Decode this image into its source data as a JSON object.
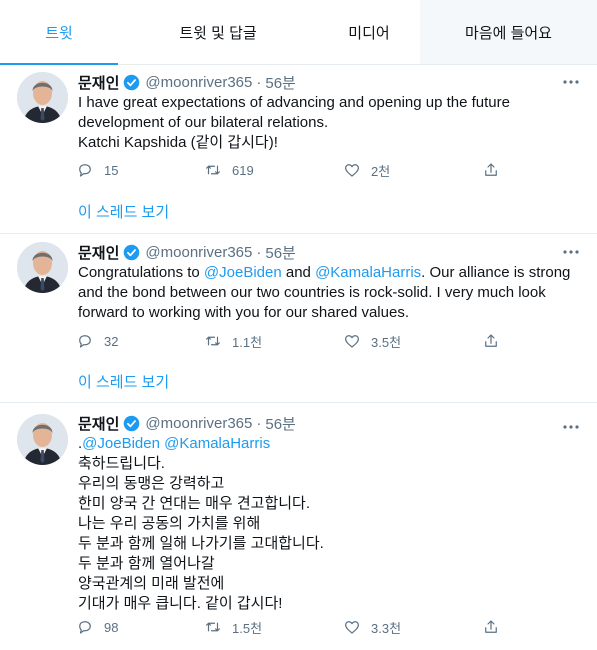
{
  "tabs": [
    {
      "label": "트윗",
      "active": true
    },
    {
      "label": "트윗 및 답글",
      "active": false
    },
    {
      "label": "미디어",
      "active": false
    },
    {
      "label": "마음에 들어요",
      "active": false
    }
  ],
  "colors": {
    "accent": "#1d9bf0",
    "muted": "#5b7083",
    "divider": "#e6ecf0"
  },
  "tweets": [
    {
      "name": "문재인",
      "handle": "@moonriver365",
      "dot": "·",
      "time": "56분",
      "lines": [
        "I have great expectations of advancing and opening up the future",
        "development of our bilateral relations.",
        "Katchi Kapshida (같이 갑시다)!"
      ],
      "reply_count": "15",
      "retweet_count": "619",
      "like_count": "2천",
      "thread_link": "이 스레드 보기"
    },
    {
      "name": "문재인",
      "handle": "@moonriver365",
      "dot": "·",
      "time": "56분",
      "line1": {
        "pre": "Congratulations to ",
        "link1": "@JoeBiden",
        "mid": " and ",
        "link2": "@KamalaHarris",
        "post": ". Our alliance is strong"
      },
      "lines": [
        "and the bond between our two countries is rock-solid. I very much look",
        "forward to working with you for our shared values."
      ],
      "reply_count": "32",
      "retweet_count": "1.1천",
      "like_count": "3.5천",
      "thread_link": "이 스레드 보기"
    },
    {
      "name": "문재인",
      "handle": "@moonriver365",
      "dot": "·",
      "time": "56분",
      "line1": {
        "pre": ".",
        "link1": "@JoeBiden",
        "mid": " ",
        "link2": "@KamalaHarris"
      },
      "lines": [
        "축하드립니다.",
        "우리의 동맹은 강력하고",
        "한미 양국 간 연대는 매우 견고합니다.",
        "나는 우리 공동의 가치를 위해",
        "두 분과 함께 일해 나가기를 고대합니다.",
        "두 분과 함께 열어나갈",
        "양국관계의 미래 발전에",
        "기대가 매우 큽니다. 같이 갑시다!"
      ],
      "reply_count": "98",
      "retweet_count": "1.5천",
      "like_count": "3.3천"
    }
  ],
  "icons": {
    "verified": "verified-badge-icon",
    "more": "more-icon",
    "reply": "reply-icon",
    "retweet": "retweet-icon",
    "like": "heart-icon",
    "share": "share-icon"
  }
}
